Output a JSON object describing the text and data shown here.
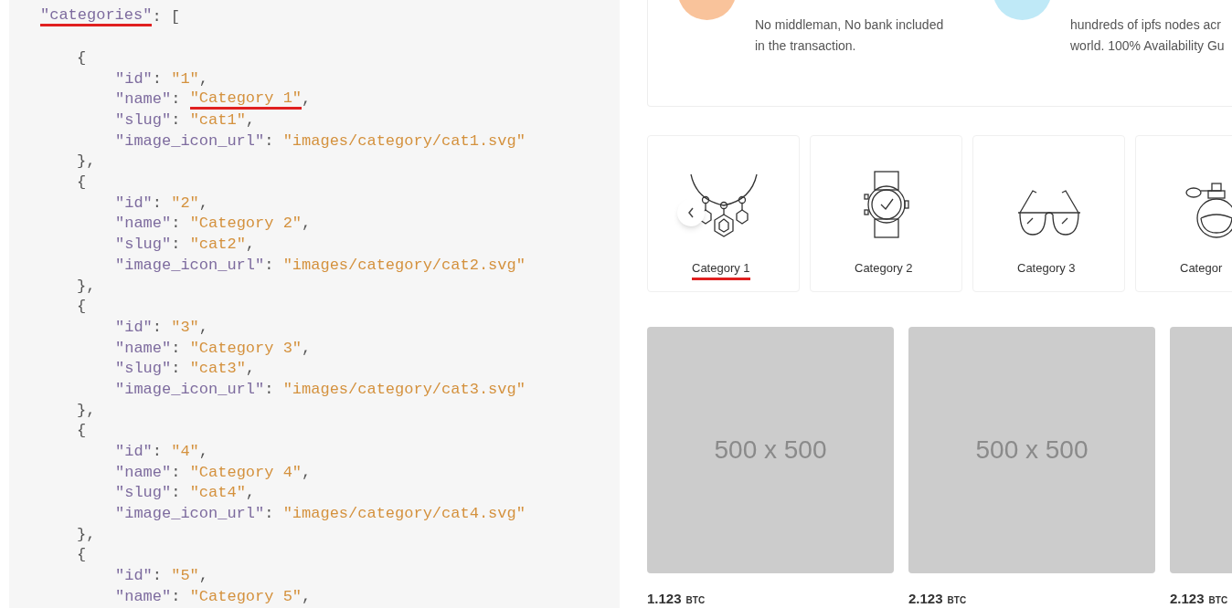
{
  "code": {
    "segments": [
      {
        "kind": "key",
        "text": "\"categories\"",
        "marked": true
      },
      {
        "kind": "punct",
        "text": ": ["
      }
    ],
    "children": [
      {
        "segments": [
          {
            "kind": "punct",
            "text": "{"
          }
        ],
        "children": [
          {
            "segments": [
              {
                "kind": "key",
                "text": "\"id\""
              },
              {
                "kind": "punct",
                "text": ": "
              },
              {
                "kind": "string",
                "text": "\"1\""
              },
              {
                "kind": "punct",
                "text": ","
              }
            ]
          },
          {
            "segments": [
              {
                "kind": "key",
                "text": "\"name\""
              },
              {
                "kind": "punct",
                "text": ": "
              },
              {
                "kind": "string",
                "text": "\"Category 1\"",
                "marked": true
              },
              {
                "kind": "punct",
                "text": ","
              }
            ]
          },
          {
            "segments": [
              {
                "kind": "key",
                "text": "\"slug\""
              },
              {
                "kind": "punct",
                "text": ": "
              },
              {
                "kind": "string",
                "text": "\"cat1\""
              },
              {
                "kind": "punct",
                "text": ","
              }
            ]
          },
          {
            "segments": [
              {
                "kind": "key",
                "text": "\"image_icon_url\""
              },
              {
                "kind": "punct",
                "text": ": "
              },
              {
                "kind": "string",
                "text": "\"images/category/cat1.svg\""
              }
            ]
          }
        ],
        "close": [
          {
            "kind": "punct",
            "text": "},"
          }
        ]
      },
      {
        "segments": [
          {
            "kind": "punct",
            "text": "{"
          }
        ],
        "children": [
          {
            "segments": [
              {
                "kind": "key",
                "text": "\"id\""
              },
              {
                "kind": "punct",
                "text": ": "
              },
              {
                "kind": "string",
                "text": "\"2\""
              },
              {
                "kind": "punct",
                "text": ","
              }
            ]
          },
          {
            "segments": [
              {
                "kind": "key",
                "text": "\"name\""
              },
              {
                "kind": "punct",
                "text": ": "
              },
              {
                "kind": "string",
                "text": "\"Category 2\""
              },
              {
                "kind": "punct",
                "text": ","
              }
            ]
          },
          {
            "segments": [
              {
                "kind": "key",
                "text": "\"slug\""
              },
              {
                "kind": "punct",
                "text": ": "
              },
              {
                "kind": "string",
                "text": "\"cat2\""
              },
              {
                "kind": "punct",
                "text": ","
              }
            ]
          },
          {
            "segments": [
              {
                "kind": "key",
                "text": "\"image_icon_url\""
              },
              {
                "kind": "punct",
                "text": ": "
              },
              {
                "kind": "string",
                "text": "\"images/category/cat2.svg\""
              }
            ]
          }
        ],
        "close": [
          {
            "kind": "punct",
            "text": "},"
          }
        ]
      },
      {
        "segments": [
          {
            "kind": "punct",
            "text": "{"
          }
        ],
        "children": [
          {
            "segments": [
              {
                "kind": "key",
                "text": "\"id\""
              },
              {
                "kind": "punct",
                "text": ": "
              },
              {
                "kind": "string",
                "text": "\"3\""
              },
              {
                "kind": "punct",
                "text": ","
              }
            ]
          },
          {
            "segments": [
              {
                "kind": "key",
                "text": "\"name\""
              },
              {
                "kind": "punct",
                "text": ": "
              },
              {
                "kind": "string",
                "text": "\"Category 3\""
              },
              {
                "kind": "punct",
                "text": ","
              }
            ]
          },
          {
            "segments": [
              {
                "kind": "key",
                "text": "\"slug\""
              },
              {
                "kind": "punct",
                "text": ": "
              },
              {
                "kind": "string",
                "text": "\"cat3\""
              },
              {
                "kind": "punct",
                "text": ","
              }
            ]
          },
          {
            "segments": [
              {
                "kind": "key",
                "text": "\"image_icon_url\""
              },
              {
                "kind": "punct",
                "text": ": "
              },
              {
                "kind": "string",
                "text": "\"images/category/cat3.svg\""
              }
            ]
          }
        ],
        "close": [
          {
            "kind": "punct",
            "text": "},"
          }
        ]
      },
      {
        "segments": [
          {
            "kind": "punct",
            "text": "{"
          }
        ],
        "children": [
          {
            "segments": [
              {
                "kind": "key",
                "text": "\"id\""
              },
              {
                "kind": "punct",
                "text": ": "
              },
              {
                "kind": "string",
                "text": "\"4\""
              },
              {
                "kind": "punct",
                "text": ","
              }
            ]
          },
          {
            "segments": [
              {
                "kind": "key",
                "text": "\"name\""
              },
              {
                "kind": "punct",
                "text": ": "
              },
              {
                "kind": "string",
                "text": "\"Category 4\""
              },
              {
                "kind": "punct",
                "text": ","
              }
            ]
          },
          {
            "segments": [
              {
                "kind": "key",
                "text": "\"slug\""
              },
              {
                "kind": "punct",
                "text": ": "
              },
              {
                "kind": "string",
                "text": "\"cat4\""
              },
              {
                "kind": "punct",
                "text": ","
              }
            ]
          },
          {
            "segments": [
              {
                "kind": "key",
                "text": "\"image_icon_url\""
              },
              {
                "kind": "punct",
                "text": ": "
              },
              {
                "kind": "string",
                "text": "\"images/category/cat4.svg\""
              }
            ]
          }
        ],
        "close": [
          {
            "kind": "punct",
            "text": "},"
          }
        ]
      },
      {
        "segments": [
          {
            "kind": "punct",
            "text": "{"
          }
        ],
        "children": [
          {
            "segments": [
              {
                "kind": "key",
                "text": "\"id\""
              },
              {
                "kind": "punct",
                "text": ": "
              },
              {
                "kind": "string",
                "text": "\"5\""
              },
              {
                "kind": "punct",
                "text": ","
              }
            ]
          },
          {
            "segments": [
              {
                "kind": "key",
                "text": "\"name\""
              },
              {
                "kind": "punct",
                "text": ": "
              },
              {
                "kind": "string",
                "text": "\"Category 5\""
              },
              {
                "kind": "punct",
                "text": ","
              }
            ]
          }
        ]
      }
    ]
  },
  "features": [
    {
      "color": "#f9c39b",
      "lines": [
        "No middleman, No bank included",
        "in the transaction."
      ]
    },
    {
      "color": "#bfe9f7",
      "lines": [
        "hundreds of ipfs nodes acr",
        "world. 100% Availability Gu"
      ]
    }
  ],
  "categories": [
    {
      "kind": "necklace",
      "name": "Category 1",
      "marked": true
    },
    {
      "kind": "watch",
      "name": "Category 2",
      "marked": false
    },
    {
      "kind": "glasses",
      "name": "Category 3",
      "marked": false
    },
    {
      "kind": "perfume",
      "name": "Categor",
      "marked": false
    }
  ],
  "products": [
    {
      "image_text": "500 x 500",
      "price": "1.123",
      "unit": "BTC"
    },
    {
      "image_text": "500 x 500",
      "price": "2.123",
      "unit": "BTC"
    },
    {
      "price": "2.123",
      "unit": "BTC"
    }
  ]
}
